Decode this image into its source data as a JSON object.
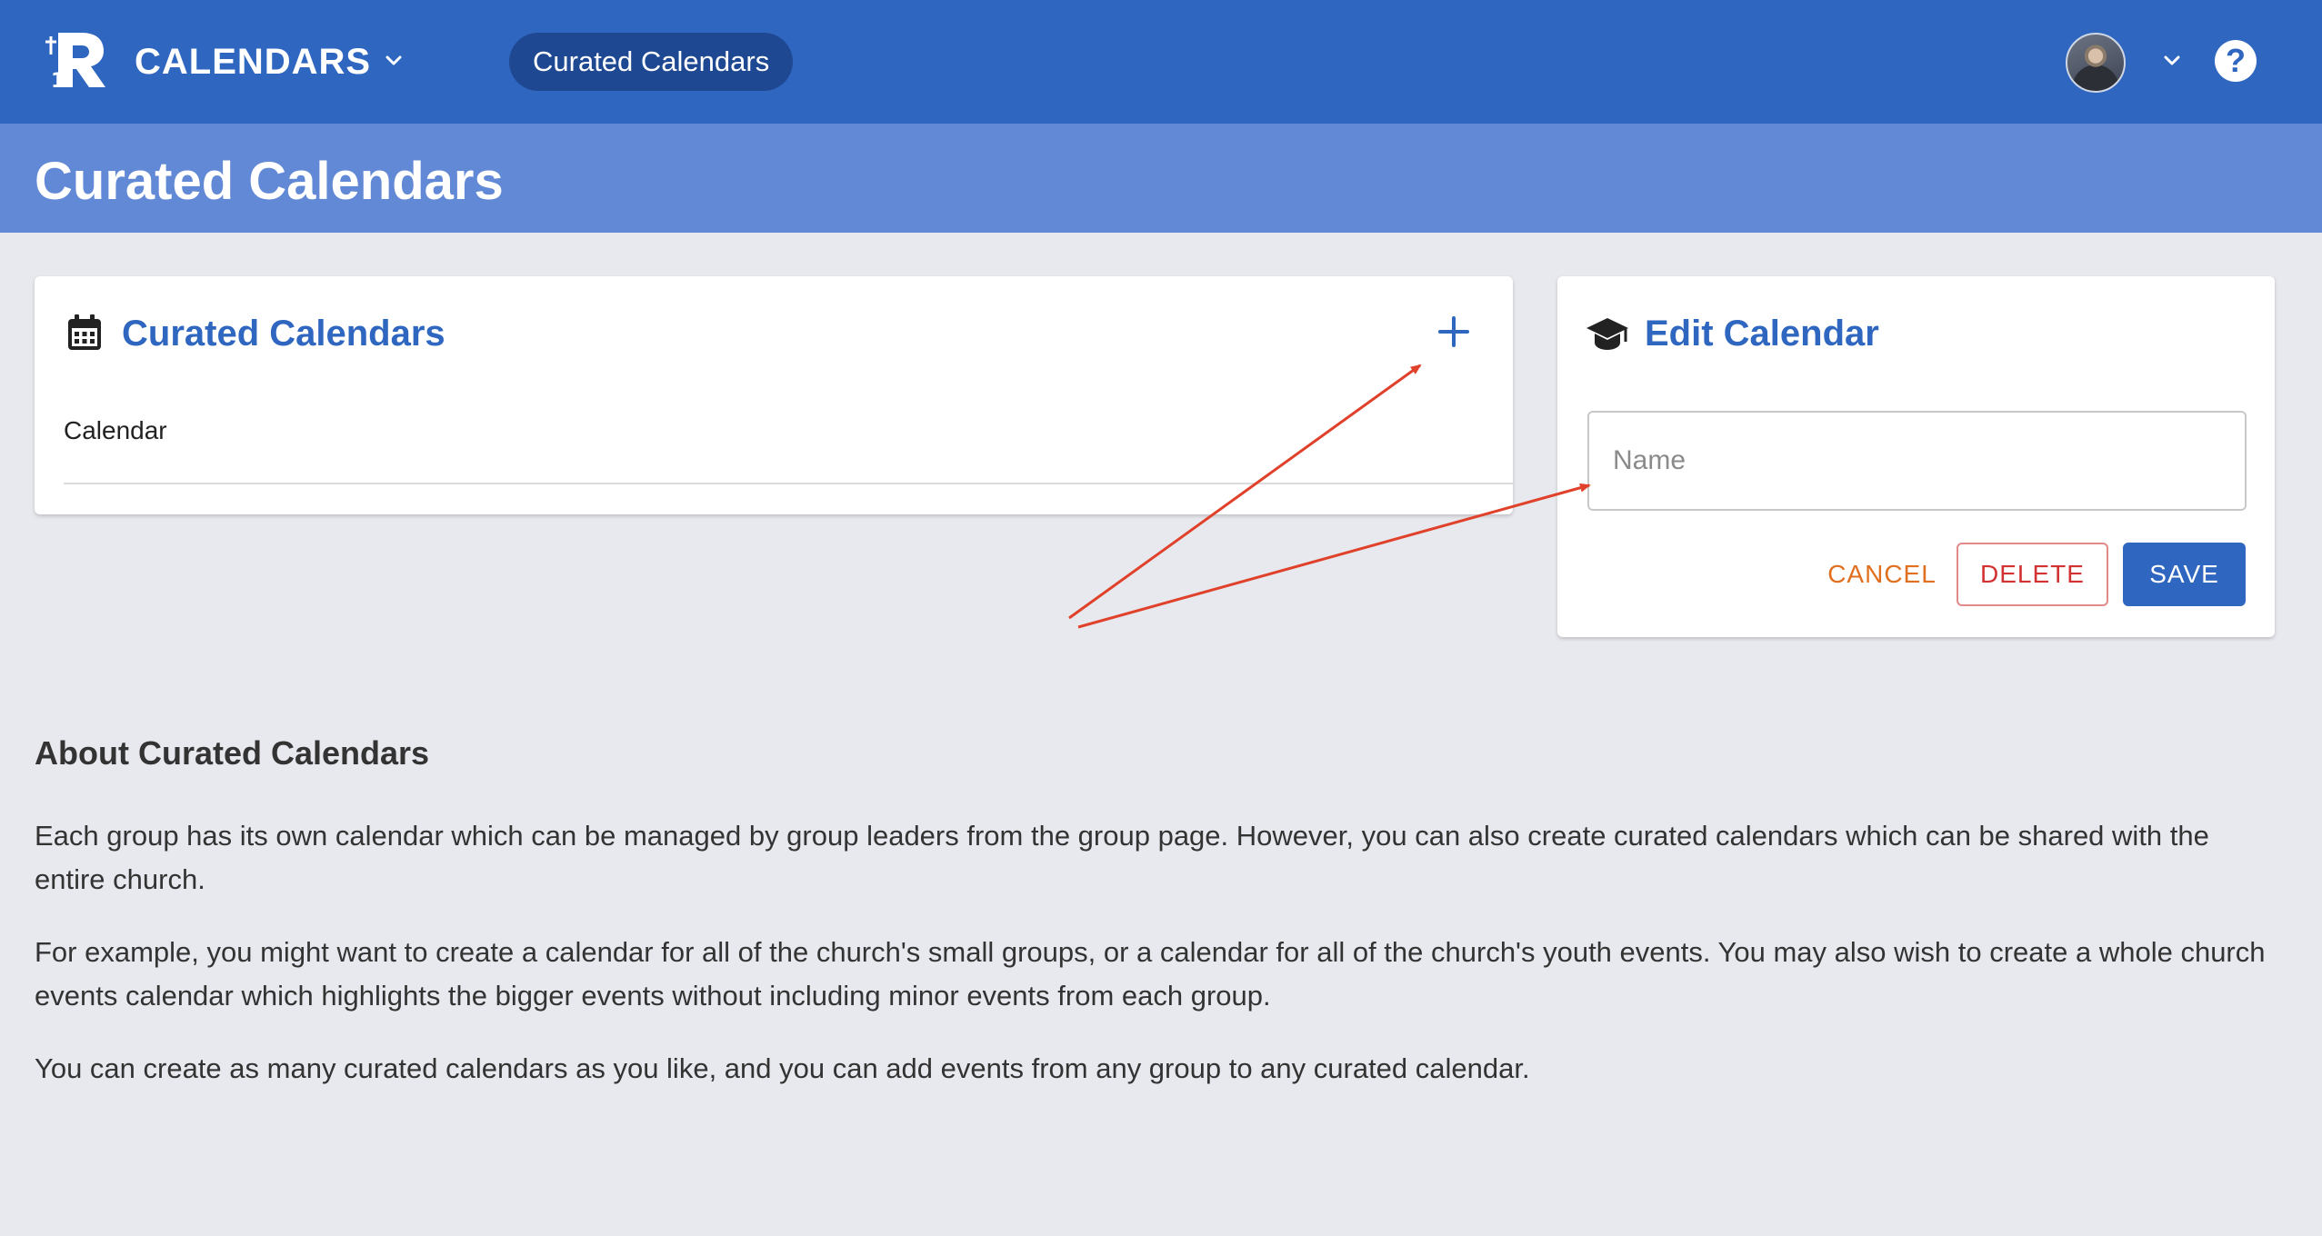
{
  "topbar": {
    "app_title": "CALENDARS",
    "nav_pill": "Curated Calendars",
    "help_symbol": "?",
    "brand_color": "#2f66bf"
  },
  "page_header": {
    "title": "Curated Calendars"
  },
  "list_card": {
    "title": "Curated Calendars",
    "icon": "calendar-icon",
    "add_icon": "plus-icon",
    "items": [
      {
        "label": "Calendar"
      }
    ]
  },
  "edit_card": {
    "title": "Edit Calendar",
    "icon": "graduation-cap-icon",
    "name_placeholder": "Name",
    "name_value": "",
    "cancel_label": "CANCEL",
    "delete_label": "DELETE",
    "save_label": "SAVE"
  },
  "about": {
    "title": "About Curated Calendars",
    "paragraphs": [
      "Each group has its own calendar which can be managed by group leaders from the group page. However, you can also create curated calendars which can be shared with the entire church.",
      "For example, you might want to create a calendar for all of the church's small groups, or a calendar for all of the church's youth events. You may also wish to create a whole church events calendar which highlights the bigger events without including minor events from each group.",
      "You can create as many curated calendars as you like, and you can add events from any group to any curated calendar."
    ]
  },
  "colors": {
    "header_light": "#6289d6",
    "cancel": "#e07020",
    "delete": "#d23232",
    "annotation": "#e0412b"
  }
}
